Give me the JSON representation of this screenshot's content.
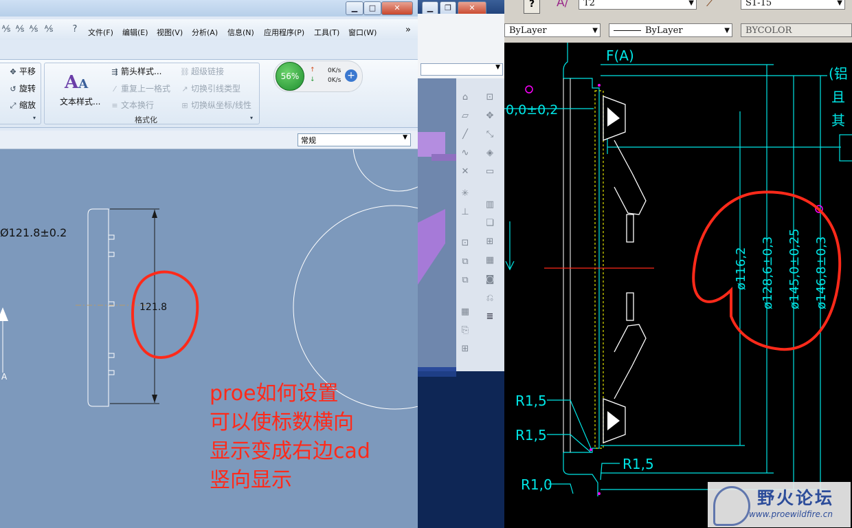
{
  "proe": {
    "menu": [
      "文件(F)",
      "编辑(E)",
      "视图(V)",
      "分析(A)",
      "信息(N)",
      "应用程序(P)",
      "工具(T)",
      "窗口(W)"
    ],
    "more": "»",
    "ribbon": {
      "move_pan": "平移",
      "move_rotate": "旋转",
      "move_zoom": "缩放",
      "text_style": "文本样式...",
      "arrow_style": "箭头样式...",
      "repeat_format": "重复上一格式",
      "text_wrap": "文本换行",
      "hyperlink": "超级链接",
      "switch_leader": "切换引线类型",
      "switch_ordinate": "切换纵坐标/线性",
      "group_format": "格式化"
    },
    "monitor": {
      "percent": "56%",
      "up": "0K/s",
      "down": "0K/s"
    },
    "style_select": "常规",
    "drawing": {
      "dim_diameter": "Ø121.8±0.2",
      "dim_value": "121.8",
      "label_a": "A"
    }
  },
  "cad": {
    "toolbar": {
      "style1": "T2",
      "style2": "S1-15",
      "layer_color": "ByLayer",
      "linetype": "ByLayer",
      "plot_color": "BYCOLOR"
    },
    "drawing": {
      "top_label": "F(A)",
      "flatness": "0,0±0,2",
      "dim_1": "ø116,2",
      "dim_2": "ø128,6±0,3",
      "dim_3": "ø145,0±0,25",
      "dim_4": "ø146,8±0,3",
      "r1": "R1,5",
      "r2": "R1,5",
      "r3": "R1,5",
      "r4": "R1,0",
      "note_1": "(铝",
      "note_2": "且",
      "note_3": "其"
    }
  },
  "annotation": "proe如何设置\n可以使标数横向\n显示变成右边cad\n竖向显示",
  "watermark": {
    "title": "野火论坛",
    "url": "www.proewildfire.cn"
  },
  "colors": {
    "annotation_red": "#ff2a1a",
    "cad_cyan": "#00e6e6",
    "cad_magenta": "#ff00ff"
  }
}
